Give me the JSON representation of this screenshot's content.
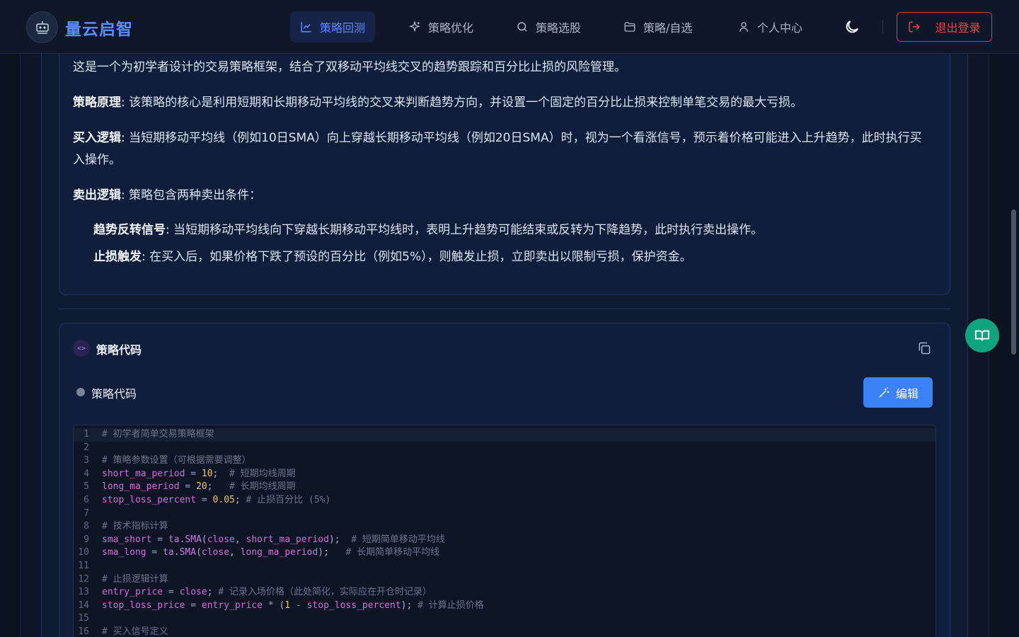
{
  "brand": {
    "name": "量云启智"
  },
  "nav": [
    {
      "label": "策略回测",
      "icon": "chart-line-icon",
      "active": true
    },
    {
      "label": "策略优化",
      "icon": "sparkles-icon",
      "active": false
    },
    {
      "label": "策略选股",
      "icon": "search-icon",
      "active": false
    },
    {
      "label": "策略/自选",
      "icon": "folder-icon",
      "active": false
    },
    {
      "label": "个人中心",
      "icon": "user-icon",
      "active": false
    }
  ],
  "header": {
    "logout_label": "退出登录",
    "theme_icon": "moon-icon"
  },
  "description": {
    "intro": "这是一个为初学者设计的交易策略框架，结合了双移动平均线交叉的趋势跟踪和百分比止损的风险管理。",
    "principle_label": "策略原理",
    "principle_text": ": 该策略的核心是利用短期和长期移动平均线的交叉来判断趋势方向，并设置一个固定的百分比止损来控制单笔交易的最大亏损。",
    "buy_label": "买入逻辑",
    "buy_text": ": 当短期移动平均线（例如10日SMA）向上穿越长期移动平均线（例如20日SMA）时，视为一个看涨信号，预示着价格可能进入上升趋势，此时执行买入操作。",
    "sell_label": "卖出逻辑",
    "sell_text": ": 策略包含两种卖出条件：",
    "sell_items": [
      {
        "label": "趋势反转信号",
        "text": ": 当短期移动平均线向下穿越长期移动平均线时，表明上升趋势可能结束或反转为下降趋势，此时执行卖出操作。"
      },
      {
        "label": "止损触发",
        "text": ": 在买入后，如果价格下跌了预设的百分比（例如5%），则触发止损，立即卖出以限制亏损，保护资金。"
      }
    ]
  },
  "code_section": {
    "title": "策略代码",
    "subtitle": "策略代码",
    "edit_label": "编辑",
    "copy_icon": "copy-icon",
    "lines": [
      "# 初学者简单交易策略框架",
      "",
      "# 策略参数设置（可根据需要调整）",
      "short_ma_period = 10;  # 短期均线周期",
      "long_ma_period = 20;   # 长期均线周期",
      "stop_loss_percent = 0.05; # 止损百分比 (5%)",
      "",
      "# 技术指标计算",
      "sma_short = ta.SMA(close, short_ma_period);  # 短期简单移动平均线",
      "sma_long = ta.SMA(close, long_ma_period);   # 长期简单移动平均线",
      "",
      "# 止损逻辑计算",
      "entry_price = close; # 记录入场价格（此处简化，实际应在开仓时记录）",
      "stop_loss_price = entry_price * (1 - stop_loss_percent); # 计算止损价格",
      "",
      "# 买入信号定义"
    ]
  },
  "float_button": {
    "icon": "book-icon"
  },
  "colors": {
    "accent": "#3b82f6",
    "brand": "#5b8cff",
    "danger": "#ef4444",
    "float": "#10a37f"
  }
}
